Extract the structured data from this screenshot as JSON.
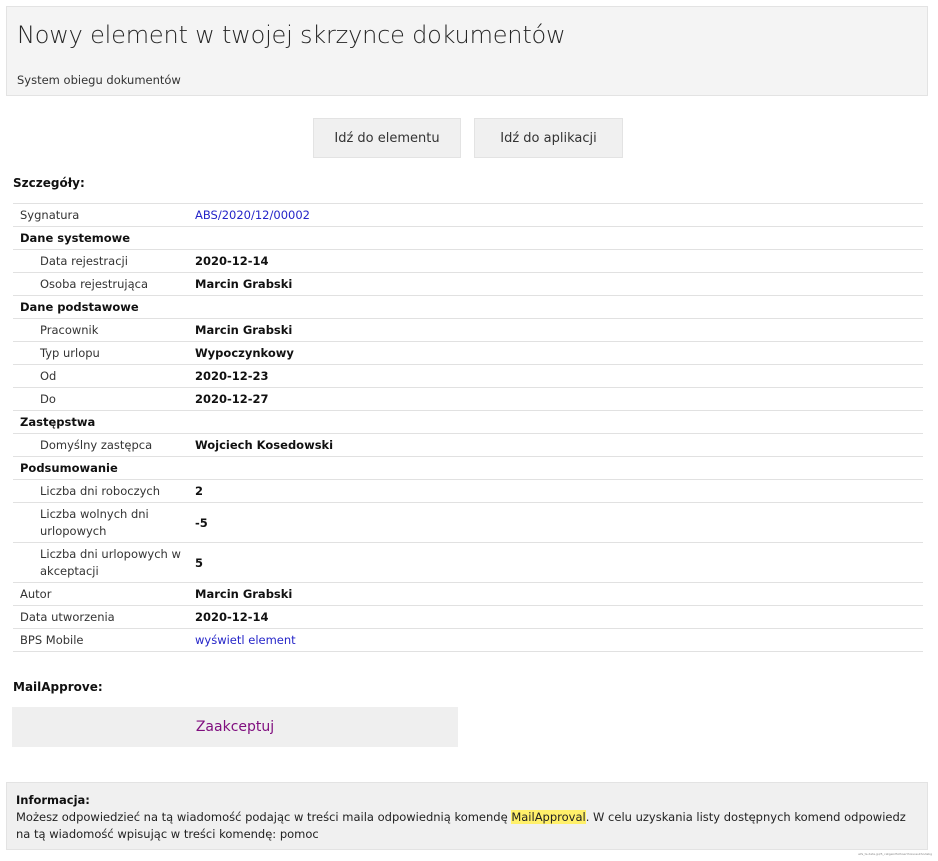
{
  "header": {
    "title": "Nowy element w twojej skrzynce dokumentów",
    "subtitle": "System obiegu dokumentów"
  },
  "buttons": {
    "go_to_item": "Idź do elementu",
    "go_to_app": "Idź do aplikacji"
  },
  "details": {
    "label": "Szczegóły:",
    "rows": [
      {
        "type": "field",
        "label": "Sygnatura",
        "value": "ABS/2020/12/00002",
        "link": true
      },
      {
        "type": "group",
        "label": "Dane systemowe"
      },
      {
        "type": "field",
        "indent": true,
        "label": "Data rejestracji",
        "value": "2020-12-14"
      },
      {
        "type": "field",
        "indent": true,
        "label": "Osoba rejestrująca",
        "value": "Marcin Grabski"
      },
      {
        "type": "group",
        "label": "Dane podstawowe"
      },
      {
        "type": "field",
        "indent": true,
        "label": "Pracownik",
        "value": "Marcin Grabski"
      },
      {
        "type": "field",
        "indent": true,
        "label": "Typ urlopu",
        "value": "Wypoczynkowy"
      },
      {
        "type": "field",
        "indent": true,
        "label": "Od",
        "value": "2020-12-23"
      },
      {
        "type": "field",
        "indent": true,
        "label": "Do",
        "value": "2020-12-27"
      },
      {
        "type": "group",
        "label": "Zastępstwa"
      },
      {
        "type": "field",
        "indent": true,
        "label": "Domyślny zastępca",
        "value": "Wojciech Kosedowski"
      },
      {
        "type": "group",
        "label": "Podsumowanie"
      },
      {
        "type": "field",
        "indent": true,
        "label": "Liczba dni roboczych",
        "value": "2"
      },
      {
        "type": "field",
        "indent": true,
        "tall": true,
        "label": "Liczba wolnych dni urlopowych",
        "value": "-5"
      },
      {
        "type": "field",
        "indent": true,
        "tall": true,
        "label": "Liczba dni urlopowych w akceptacji",
        "value": "5"
      },
      {
        "type": "field",
        "label": "Autor",
        "value": "Marcin Grabski"
      },
      {
        "type": "field",
        "label": "Data utworzenia",
        "value": "2020-12-14"
      },
      {
        "type": "field",
        "label": "BPS Mobile",
        "value": "wyświetl element",
        "link": true
      }
    ]
  },
  "mail_approve": {
    "label": "MailApprove:",
    "accept": "Zaakceptuj"
  },
  "info": {
    "title": "Informacja:",
    "text_before": "Możesz odpowiedzieć na tą wiadomość podając w treści maila odpowiednią komendę ",
    "highlight": "MailApproval",
    "text_after": ". W celu uzyskania listy dostępnych komend odpowiedz na tą wiadomość wpisując w treści komendę: pomoc"
  },
  "footer": {
    "id_text": "wfs_ts.data.jpl/5_catgeinfisthoerthoisoeuthodabg"
  },
  "colors": {
    "link": "#2525c8",
    "accept_link": "#800f7f",
    "highlight": "#fff06a",
    "panel_bg": "#f4f4f4"
  }
}
